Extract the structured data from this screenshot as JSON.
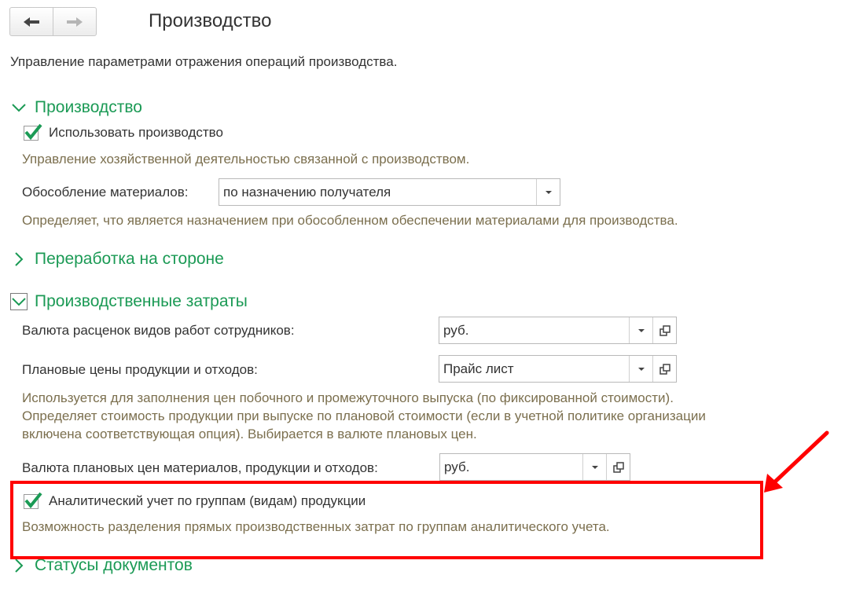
{
  "header": {
    "title": "Производство",
    "description": "Управление параметрами отражения операций производства."
  },
  "sections": {
    "production": {
      "title": "Производство",
      "use_checkbox_label": "Использовать производство",
      "use_checked": true,
      "use_hint": "Управление хозяйственной деятельностью связанной с производством.",
      "isolation_label": "Обособление материалов:",
      "isolation_value": "по назначению получателя",
      "isolation_hint": "Определяет, что является назначением при обособленном обеспечении материалами для производства."
    },
    "outsourcing": {
      "title": "Переработка на стороне"
    },
    "costs": {
      "title": "Производственные затраты",
      "work_rate_currency_label": "Валюта расценок видов работ сотрудников:",
      "work_rate_currency_value": "руб.",
      "planned_prices_label": "Плановые цены продукции и отходов:",
      "planned_prices_value": "Прайс лист",
      "planned_prices_hint_1": "Используется для заполнения цен побочного и промежуточного выпуска (по фиксированной стоимости).",
      "planned_prices_hint_2": "Определяет стоимость продукции при выпуске по плановой стоимости (если в учетной политике организации",
      "planned_prices_hint_3": "включена соответствующая опция). Выбирается в валюте плановых цен.",
      "planned_currency_label": "Валюта плановых цен материалов, продукции и отходов:",
      "planned_currency_value": "руб.",
      "analytic_checkbox_label": "Аналитический учет по группам (видам) продукции",
      "analytic_checked": true,
      "analytic_hint": "Возможность разделения прямых производственных затрат по группам аналитического учета."
    },
    "doc_statuses": {
      "title": "Статусы документов"
    }
  },
  "colors": {
    "section_green": "#1b9a55",
    "hint_olive": "#7b6f4e",
    "annotation_red": "#ff0000"
  },
  "icons": {
    "back": "arrow-left-icon",
    "forward": "arrow-right-icon",
    "expanded": "chevron-down-icon",
    "collapsed": "chevron-right-icon",
    "dropdown": "triangle-down-icon",
    "open": "open-form-icon",
    "check": "checkmark-icon"
  }
}
